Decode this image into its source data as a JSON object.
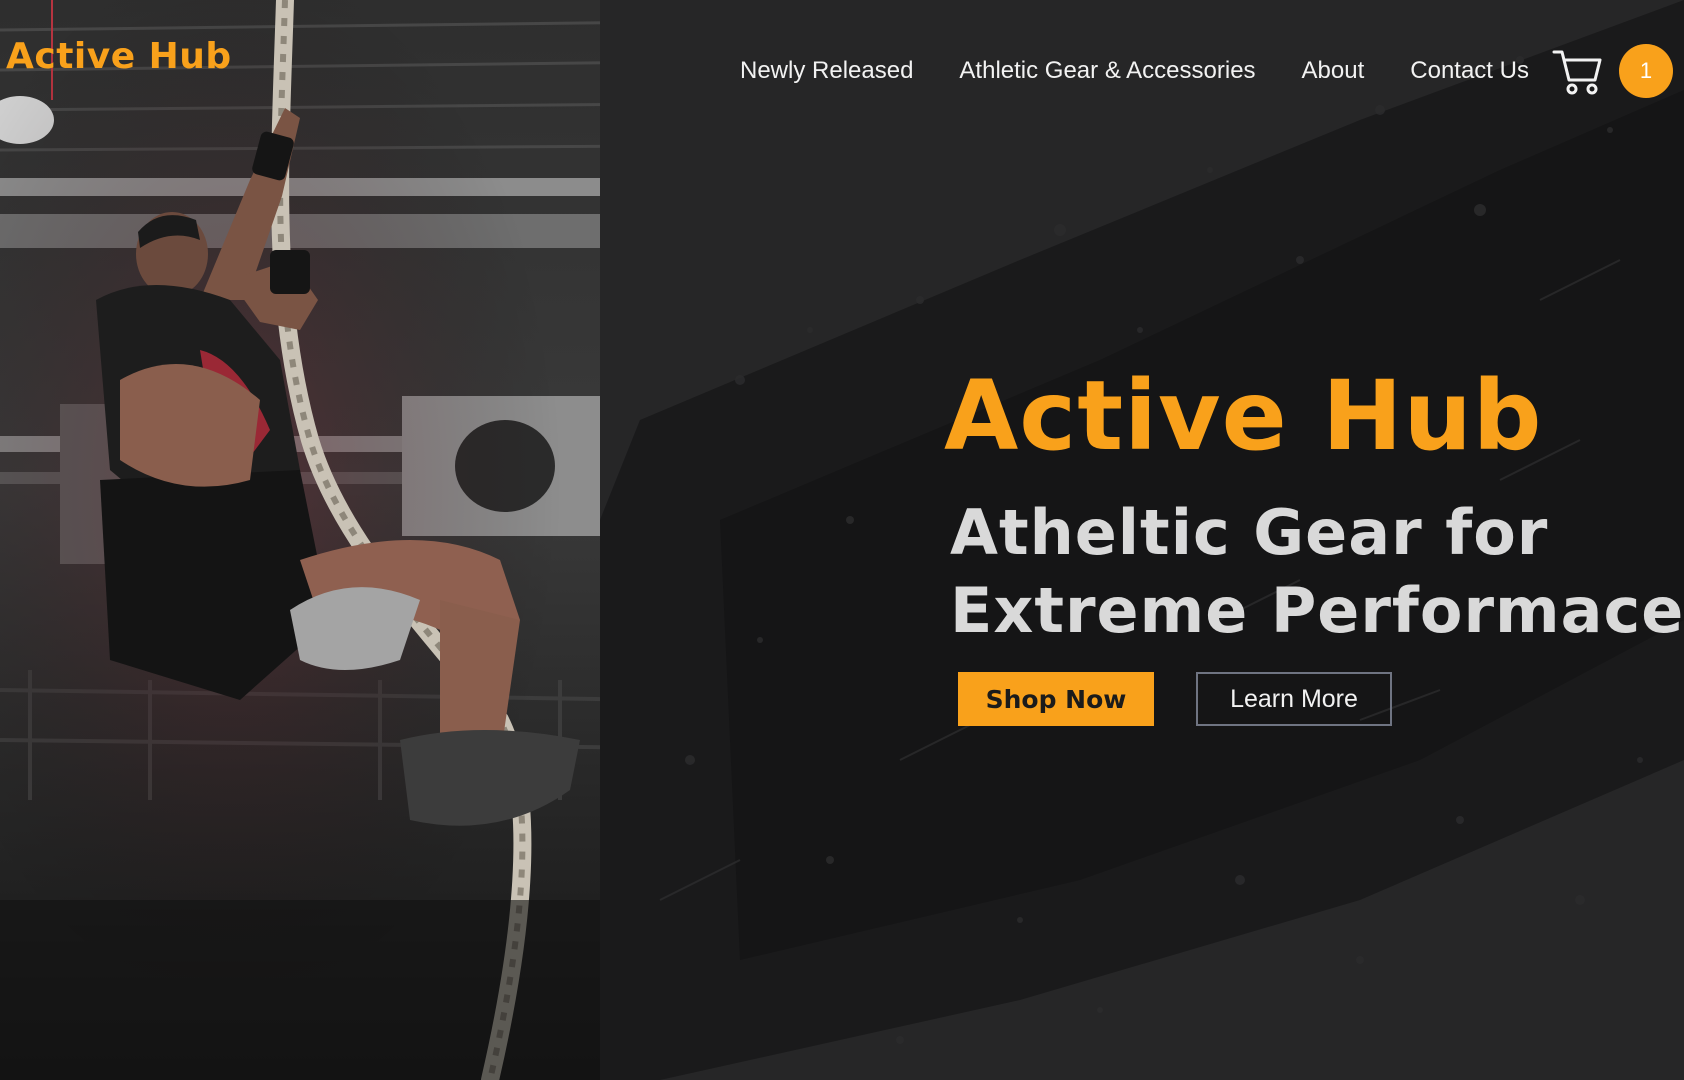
{
  "brand": {
    "logo_text": "Active Hub",
    "accent_color": "#f9a11b"
  },
  "nav": {
    "items": [
      {
        "label": "Newly Released"
      },
      {
        "label": "Athletic Gear & Accessories"
      },
      {
        "label": "About"
      },
      {
        "label": "Contact Us"
      }
    ],
    "cart_icon": "shopping-cart-icon",
    "cart_count": "1"
  },
  "hero": {
    "title": "Active Hub",
    "subtitle": "Atheltic Gear for Extreme Performace",
    "primary_button": "Shop Now",
    "secondary_button": "Learn More",
    "image": "athlete-climbing-rope-photo"
  }
}
